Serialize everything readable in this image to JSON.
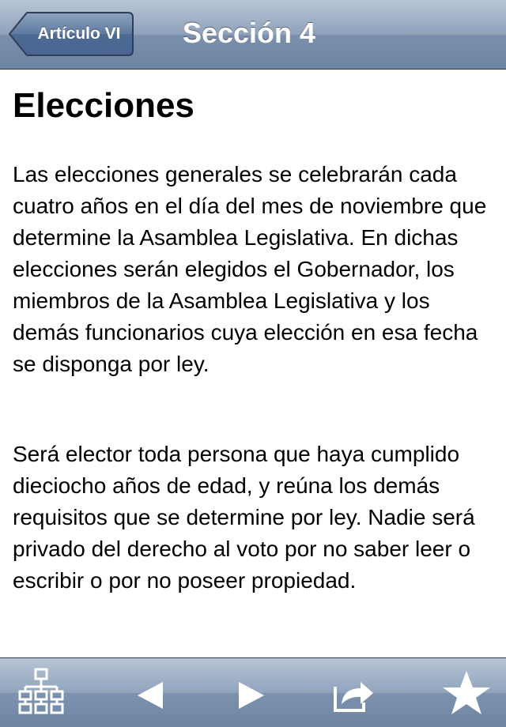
{
  "navbar": {
    "back_label": "Artículo VI",
    "title": "Sección 4"
  },
  "content": {
    "heading": "Elecciones",
    "paragraphs": [
      "Las elecciones generales se celebrarán cada cuatro años en el día del mes de noviembre que determine la Asamblea Legislativa. En dichas elecciones serán elegidos el Gobernador, los miembros de la Asamblea Legislativa y los demás funcionarios cuya elección en esa fecha se disponga por ley.",
      "Será elector toda persona que haya cumplido dieciocho años de edad, y reúna los demás requisitos que se determine por ley. Nadie será privado del derecho al voto por no saber leer o escribir o por no poseer propiedad."
    ]
  },
  "toolbar": {
    "items": [
      {
        "icon": "hierarchy-icon"
      },
      {
        "icon": "previous-arrow-icon"
      },
      {
        "icon": "next-arrow-icon"
      },
      {
        "icon": "share-icon"
      },
      {
        "icon": "star-icon"
      }
    ]
  },
  "colors": {
    "bar_blue": "#7a90ac",
    "bar_border": "#2d3642",
    "text": "#000000",
    "background": "#ffffff"
  }
}
